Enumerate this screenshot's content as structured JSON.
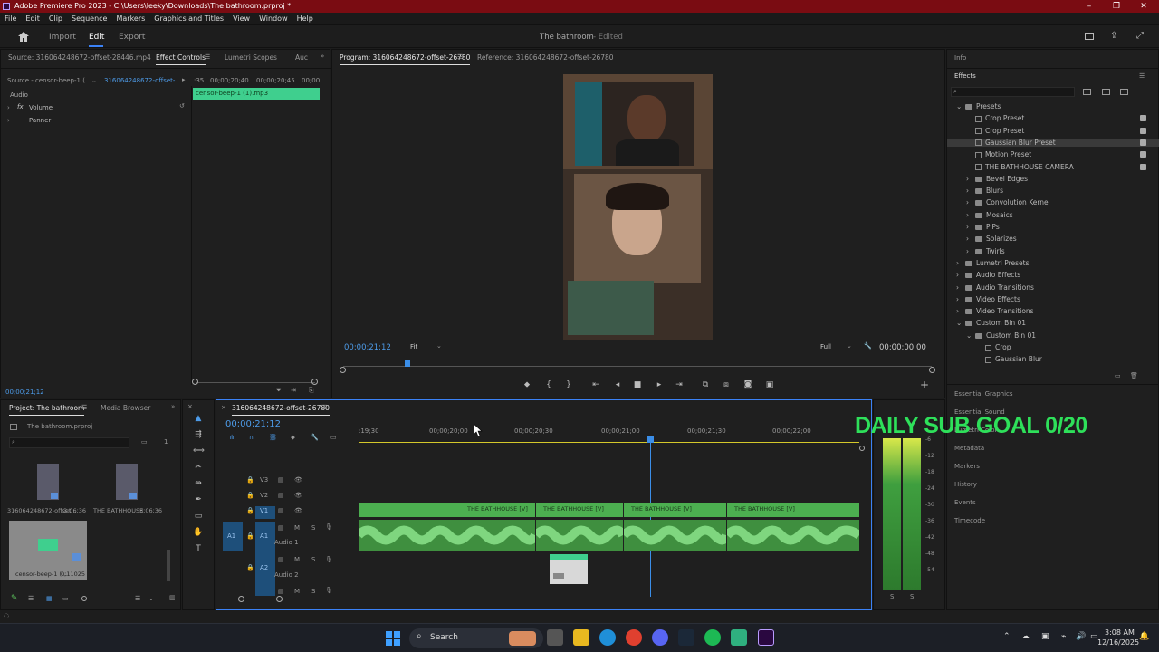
{
  "window": {
    "title": "Adobe Premiere Pro 2023 - C:\\Users\\leeky\\Downloads\\The bathroom.prproj *",
    "minimize": "–",
    "maximize": "❐",
    "close": "✕"
  },
  "menu": [
    "File",
    "Edit",
    "Clip",
    "Sequence",
    "Markers",
    "Graphics and Titles",
    "View",
    "Window",
    "Help"
  ],
  "header": {
    "tabs": [
      "Import",
      "Edit",
      "Export"
    ],
    "project_title": "The bathroom",
    "status": "- Edited"
  },
  "source_panel": {
    "tabs": [
      "Source: 316064248672-offset-28446.mp4",
      "Effect Controls",
      "Lumetri Scopes",
      "Auc"
    ],
    "source_dropdown": "Source - censor-beep-1 (...",
    "sequence_link": "316064248672-offset-...",
    "ruler": [
      ":35",
      "00;00;20;40",
      "00;00;20;45",
      "00;00"
    ],
    "clip_name": "censor-beep-1 (1).mp3",
    "section": "Audio",
    "effects": [
      {
        "fx": "fx",
        "name": "Volume"
      },
      {
        "fx": "",
        "name": "Panner"
      }
    ],
    "timecode": "00;00;21;12"
  },
  "program_monitor": {
    "tabs": [
      "Program: 316064248672-offset-26780",
      "Reference: 316064248672-offset-26780"
    ],
    "timecode": "00;00;21;12",
    "fit": "Fit",
    "quality": "Full",
    "duration": "00;00;00;00"
  },
  "right_panel": {
    "info_tab": "Info",
    "effects_tab": "Effects",
    "tree": [
      {
        "label": "Presets",
        "type": "folder",
        "level": 0,
        "open": true
      },
      {
        "label": "Crop Preset",
        "type": "preset",
        "level": 1
      },
      {
        "label": "Crop Preset",
        "type": "preset",
        "level": 1
      },
      {
        "label": "Gaussian Blur Preset",
        "type": "preset",
        "level": 1,
        "selected": true
      },
      {
        "label": "Motion Preset",
        "type": "preset",
        "level": 1
      },
      {
        "label": "THE BATHHOUSE CAMERA",
        "type": "preset",
        "level": 1
      },
      {
        "label": "Bevel Edges",
        "type": "folder",
        "level": 1
      },
      {
        "label": "Blurs",
        "type": "folder",
        "level": 1
      },
      {
        "label": "Convolution Kernel",
        "type": "folder",
        "level": 1
      },
      {
        "label": "Mosaics",
        "type": "folder",
        "level": 1
      },
      {
        "label": "PiPs",
        "type": "folder",
        "level": 1
      },
      {
        "label": "Solarizes",
        "type": "folder",
        "level": 1
      },
      {
        "label": "Twirls",
        "type": "folder",
        "level": 1
      },
      {
        "label": "Lumetri Presets",
        "type": "folder",
        "level": 0
      },
      {
        "label": "Audio Effects",
        "type": "folder",
        "level": 0
      },
      {
        "label": "Audio Transitions",
        "type": "folder",
        "level": 0
      },
      {
        "label": "Video Effects",
        "type": "folder",
        "level": 0
      },
      {
        "label": "Video Transitions",
        "type": "folder",
        "level": 0
      },
      {
        "label": "Custom Bin 01",
        "type": "folder",
        "level": 0,
        "open": true
      },
      {
        "label": "Custom Bin 01",
        "type": "folder",
        "level": 1,
        "open": true
      },
      {
        "label": "Crop",
        "type": "preset",
        "level": 2
      },
      {
        "label": "Gaussian Blur",
        "type": "preset",
        "level": 2
      }
    ],
    "sections": [
      "Essential Graphics",
      "Essential Sound",
      "Lumetri Color",
      "Metadata",
      "Markers",
      "History",
      "Events",
      "Timecode"
    ]
  },
  "project_panel": {
    "tabs": [
      "Project: The bathroom",
      "Media Browser"
    ],
    "file": "The bathroom.prproj",
    "page": "1",
    "items": [
      {
        "name": "316064248672-offset...",
        "duration": "3;06;36"
      },
      {
        "name": "THE BATHHOUSE",
        "duration": "3;06;36"
      },
      {
        "name": "censor-beep-1 (...",
        "duration": "0;11025"
      }
    ]
  },
  "timeline": {
    "tab": "316064248672-offset-26780",
    "timecode": "00;00;21;12",
    "ruler": [
      ":19;30",
      "00;00;20;00",
      "00;00;20;30",
      "00;00;21;00",
      "00;00;21;30",
      "00;00;22;00"
    ],
    "tracks": [
      {
        "id": "V3",
        "label": ""
      },
      {
        "id": "V2",
        "label": ""
      },
      {
        "id": "V1",
        "label": ""
      },
      {
        "id": "A1",
        "label": "Audio 1",
        "source": "A1"
      },
      {
        "id": "A2",
        "label": "Audio 2"
      },
      {
        "id": "",
        "label": ""
      }
    ],
    "video_clips": [
      "THE BATHHOUSE [V]",
      "THE BATHHOUSE [V]",
      "THE BATHHOUSE [V]",
      "THE BATHHOUSE [V]"
    ],
    "meter_labels": [
      "-6",
      "-12",
      "-18",
      "-24",
      "-30",
      "-36",
      "-42",
      "-48",
      "-54"
    ],
    "meter_solo": [
      "S",
      "S"
    ]
  },
  "overlay": {
    "goal_text": "DAILY SUB GOAL 0/20"
  },
  "taskbar": {
    "search": "Search",
    "time": "3:08 AM",
    "date": "12/16/2025"
  }
}
